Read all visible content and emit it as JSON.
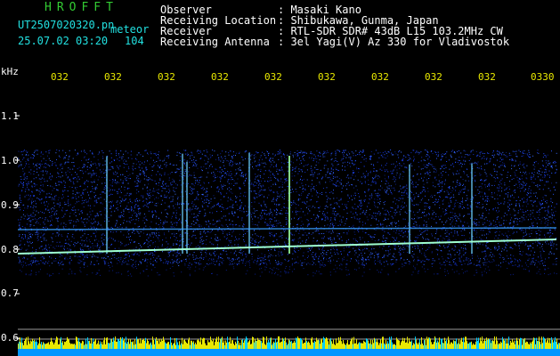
{
  "header": {
    "app_title": "HROFFT",
    "file_name": "UT2507020320.pn",
    "mode_label": "meteor",
    "timestamp": "25.07.02 03:20",
    "count": "104",
    "fields": [
      {
        "label": "Observer",
        "value": ": Masaki Kano"
      },
      {
        "label": "Receiving Location",
        "value": ": Shibukawa, Gunma, Japan"
      },
      {
        "label": "Receiver",
        "value": ": RTL-SDR SDR# 43dB L15 103.2MHz CW"
      },
      {
        "label": "Receiving Antenna",
        "value": ": 3el Yagi(V) Az 330 for Vladivostok"
      }
    ]
  },
  "spectrogram": {
    "y_unit": "kHz",
    "y_ticks": [
      "1.1",
      "1.0",
      "0.9",
      "0.8",
      "0.7",
      "0.6"
    ],
    "x_ticks": [
      "032",
      "032",
      "032",
      "032",
      "032",
      "032",
      "032",
      "032",
      "032",
      "0330"
    ]
  },
  "colors": {
    "title_green": "#33cc33",
    "text_cyan": "#22e0e0",
    "tick_yellow": "#e8e800",
    "noise_blue": "#1a3cff",
    "bottom_bar": "#0096ff"
  }
}
